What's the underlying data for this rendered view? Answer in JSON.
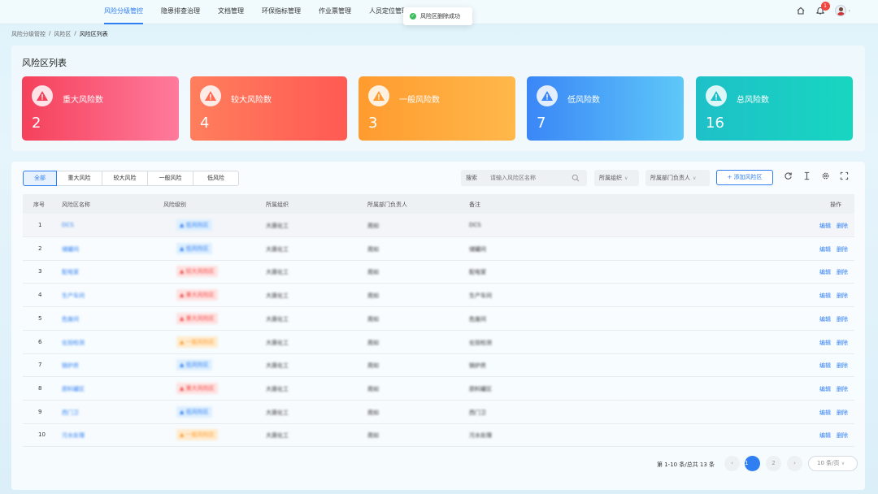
{
  "nav": {
    "items": [
      {
        "label": "风险分级管控",
        "active": true
      },
      {
        "label": "隐患排查治理",
        "active": false
      },
      {
        "label": "文档管理",
        "active": false
      },
      {
        "label": "环保指标管理",
        "active": false
      },
      {
        "label": "作业票管理",
        "active": false
      },
      {
        "label": "人员定位管理",
        "active": false
      }
    ],
    "notification_count": "1",
    "home_icon": "home-icon",
    "bell_icon": "bell-icon"
  },
  "toast": {
    "text": "风险区删除成功",
    "icon": "check-circle-icon"
  },
  "breadcrumb": {
    "items": [
      "风险分级管控",
      "风险区",
      "风险区列表"
    ],
    "separator": "/"
  },
  "summary": {
    "title": "风险区列表",
    "cards": [
      {
        "label": "重大风险数",
        "value": "2",
        "color_from": "#f5415b",
        "color_to": "#ff7a9c"
      },
      {
        "label": "较大风险数",
        "value": "4",
        "color_from": "#ff7e5c",
        "color_to": "#ff5a54"
      },
      {
        "label": "一般风险数",
        "value": "3",
        "color_from": "#ff9b2f",
        "color_to": "#ffb84a"
      },
      {
        "label": "低风险数",
        "value": "7",
        "color_from": "#3a86f7",
        "color_to": "#5ec8f8"
      },
      {
        "label": "总风险数",
        "value": "16",
        "color_from": "#1ec0c8",
        "color_to": "#17d6c0"
      }
    ]
  },
  "filters": {
    "levels": [
      {
        "label": "全部",
        "active": true
      },
      {
        "label": "重大风险",
        "active": false
      },
      {
        "label": "较大风险",
        "active": false
      },
      {
        "label": "一般风险",
        "active": false
      },
      {
        "label": "低风险",
        "active": false
      }
    ],
    "search_label": "搜索",
    "search_placeholder": "请输入风险区名称",
    "org_dropdown": "所属组织",
    "owner_dropdown": "所属部门负责人",
    "add_button": "+ 添加风险区"
  },
  "table": {
    "headers": [
      "序号",
      "风险区名称",
      "风险级别",
      "所属组织",
      "所属部门负责人",
      "备注",
      "操作"
    ],
    "rows": [
      {
        "no": "1",
        "name": "DCS",
        "level": "低风险区",
        "type": "low",
        "org": "大唐化工",
        "owner": "周如",
        "note": "DCS"
      },
      {
        "no": "2",
        "name": "储罐间",
        "level": "低风险区",
        "type": "low",
        "org": "大唐化工",
        "owner": "周如",
        "note": "储罐间"
      },
      {
        "no": "3",
        "name": "配电室",
        "level": "较大风险区",
        "type": "big",
        "org": "大唐化工",
        "owner": "周如",
        "note": "配电室"
      },
      {
        "no": "4",
        "name": "生产车间",
        "level": "重大风险区",
        "type": "big",
        "org": "大唐化工",
        "owner": "周如",
        "note": "生产车间"
      },
      {
        "no": "5",
        "name": "危废间",
        "level": "重大风险区",
        "type": "big",
        "org": "大唐化工",
        "owner": "周如",
        "note": "危废间"
      },
      {
        "no": "6",
        "name": "化验检测",
        "level": "一般风险区",
        "type": "gen",
        "org": "大唐化工",
        "owner": "周如",
        "note": "化验检测"
      },
      {
        "no": "7",
        "name": "锅炉房",
        "level": "低风险区",
        "type": "low",
        "org": "大唐化工",
        "owner": "周如",
        "note": "锅炉房"
      },
      {
        "no": "8",
        "name": "原料罐区",
        "level": "重大风险区",
        "type": "big",
        "org": "大唐化工",
        "owner": "周如",
        "note": "原料罐区"
      },
      {
        "no": "9",
        "name": "西门卫",
        "level": "低风险区",
        "type": "low",
        "org": "大唐化工",
        "owner": "周如",
        "note": "西门卫"
      },
      {
        "no": "10",
        "name": "污水处理",
        "level": "一般风险区",
        "type": "gen",
        "org": "大唐化工",
        "owner": "周如",
        "note": "污水处理"
      }
    ],
    "edit_label": "编辑",
    "delete_label": "删除"
  },
  "pagination": {
    "summary": "第 1-10 条/总共 13 条",
    "prev": "‹",
    "next": "›",
    "pages": [
      "1",
      "2"
    ],
    "page_size": "10 条/页"
  }
}
